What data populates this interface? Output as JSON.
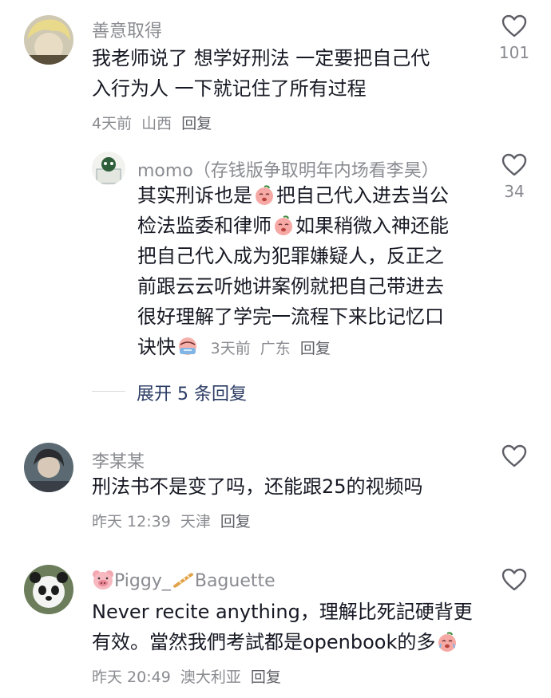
{
  "comments": [
    {
      "username": "善意取得",
      "lines": [
        "我老师说了 想学好刑法 一定要把自己代",
        "入行为人 一下就记住了所有过程"
      ],
      "time": "4天前",
      "location": "山西",
      "reply_label": "回复",
      "likes": "101"
    },
    {
      "username": "momo（存钱版争取明年内场看李昊）",
      "lines": [
        "其实刑诉也是",
        "把自己代入进去当公",
        "检法监委和律师",
        "如果稍微入神还能",
        "把自己代入成为犯罪嫌疑人，反正之",
        "前跟云云听她讲案例就把自己带进去",
        "很好理解了学完一流程下来比记忆口",
        "诀快"
      ],
      "time": "3天前",
      "location": "广东",
      "reply_label": "回复",
      "likes": "34"
    },
    {
      "username": "李某某",
      "lines": [
        "刑法书不是变了吗，还能跟25的视频吗"
      ],
      "time": "昨天 12:39",
      "location": "天津",
      "reply_label": "回复",
      "likes": ""
    },
    {
      "username_a": "Piggy_",
      "username_b": "Baguette",
      "lines": [
        "Never recite anything，理解比死記硬背更",
        "有效。當然我們考試都是openbook的多"
      ],
      "time": "昨天 20:49",
      "location": "澳大利亚",
      "reply_label": "回复",
      "likes": ""
    }
  ],
  "expand_replies": "展开 5 条回复",
  "icons": {
    "like": "heart-outline-icon",
    "emoji_sad": "crying-peach-emoji",
    "emoji_sweat": "sweating-peach-emoji",
    "pig": "pig-face-emoji",
    "bread": "baguette-emoji"
  },
  "colors": {
    "text": "#161823",
    "muted": "#8a8b91",
    "link": "#2a3b63"
  }
}
